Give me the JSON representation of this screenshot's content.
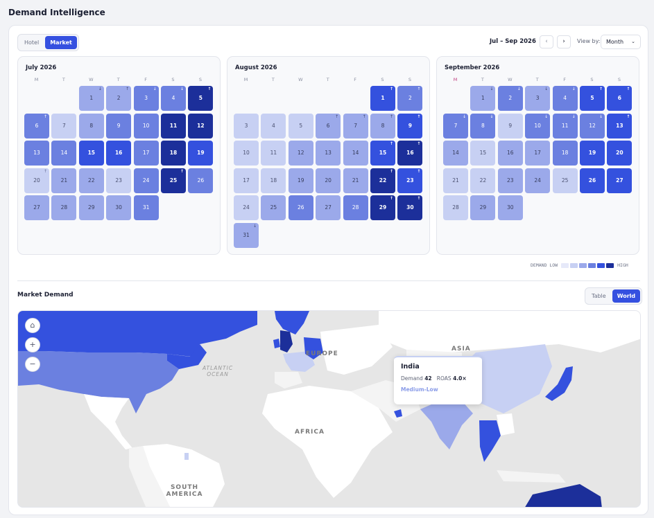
{
  "page": {
    "title": "Demand Intelligence"
  },
  "toolbar": {
    "view_tabs": [
      "Hotel",
      "Market"
    ],
    "active_view": "Market",
    "range_label": "Jul – Sep 2026",
    "prev_icon": "chevron-left-icon",
    "next_icon": "chevron-right-icon",
    "view_by_label": "View by:",
    "view_by_value": "Month"
  },
  "calendar": {
    "weekday_labels": [
      "M",
      "T",
      "W",
      "T",
      "F",
      "S",
      "S"
    ],
    "months": [
      {
        "title": "July 2026",
        "first_weekday": 2,
        "levels": [
          2,
          2,
          3,
          3,
          5,
          3,
          1,
          2,
          3,
          3,
          5,
          5,
          3,
          3,
          4,
          4,
          3,
          5,
          4,
          1,
          2,
          2,
          1,
          3,
          5,
          3,
          2,
          2,
          2,
          2,
          3
        ],
        "trends": [
          "down",
          "up",
          "down",
          "down",
          "up",
          "up",
          "",
          "",
          "",
          "",
          "",
          "",
          "",
          "",
          "",
          "",
          "",
          "",
          "",
          "up",
          "",
          "",
          "",
          "",
          "up",
          "",
          "",
          "",
          "",
          "",
          ""
        ]
      },
      {
        "title": "August 2026",
        "first_weekday": 5,
        "levels": [
          4,
          3,
          1,
          1,
          1,
          2,
          2,
          2,
          4,
          1,
          1,
          2,
          2,
          2,
          4,
          5,
          1,
          1,
          2,
          2,
          2,
          5,
          4,
          1,
          2,
          3,
          2,
          3,
          5,
          5,
          2
        ],
        "trends": [
          "up",
          "up",
          "",
          "",
          "",
          "up",
          "up",
          "up",
          "up",
          "",
          "",
          "",
          "",
          "",
          "up",
          "up",
          "",
          "",
          "",
          "",
          "",
          "up",
          "up",
          "",
          "",
          "",
          "",
          "",
          "up",
          "up",
          "down"
        ]
      },
      {
        "title": "September 2026",
        "first_weekday": 1,
        "levels": [
          2,
          3,
          2,
          3,
          4,
          4,
          3,
          3,
          1,
          3,
          3,
          3,
          4,
          2,
          1,
          2,
          2,
          3,
          4,
          4,
          1,
          1,
          2,
          2,
          1,
          4,
          4,
          1,
          2,
          2
        ],
        "trends": [
          "down",
          "down",
          "down",
          "down",
          "up",
          "up",
          "down",
          "down",
          "",
          "down",
          "down",
          "down",
          "up",
          "",
          "",
          "",
          "",
          "",
          "",
          "",
          "",
          "",
          "",
          "",
          "",
          "",
          "",
          "",
          "",
          ""
        ]
      }
    ],
    "legend": {
      "label_low": "DEMAND  LOW",
      "label_high": "HIGH",
      "colors": [
        "#e6e9f9",
        "#c7d0f3",
        "#9ba9ea",
        "#6b80e0",
        "#3451de",
        "#1c2f9a"
      ]
    }
  },
  "market": {
    "section_title": "Market Demand",
    "tabs": [
      "Table",
      "World"
    ],
    "active_tab": "World",
    "map_controls": [
      "home-icon",
      "zoom-in-icon",
      "zoom-out-icon"
    ],
    "map_labels": {
      "ocean": "ATLANTIC OCEAN",
      "asia": "ASIA",
      "europe": "EUROPE",
      "africa": "AFRICA",
      "south_america": "SOUTH AMERICA"
    },
    "tooltip": {
      "country": "India",
      "demand_label": "Demand",
      "demand_value": "42",
      "roas_label": "ROAS",
      "roas_value": "4.0×",
      "level": "Medium-Low"
    }
  }
}
